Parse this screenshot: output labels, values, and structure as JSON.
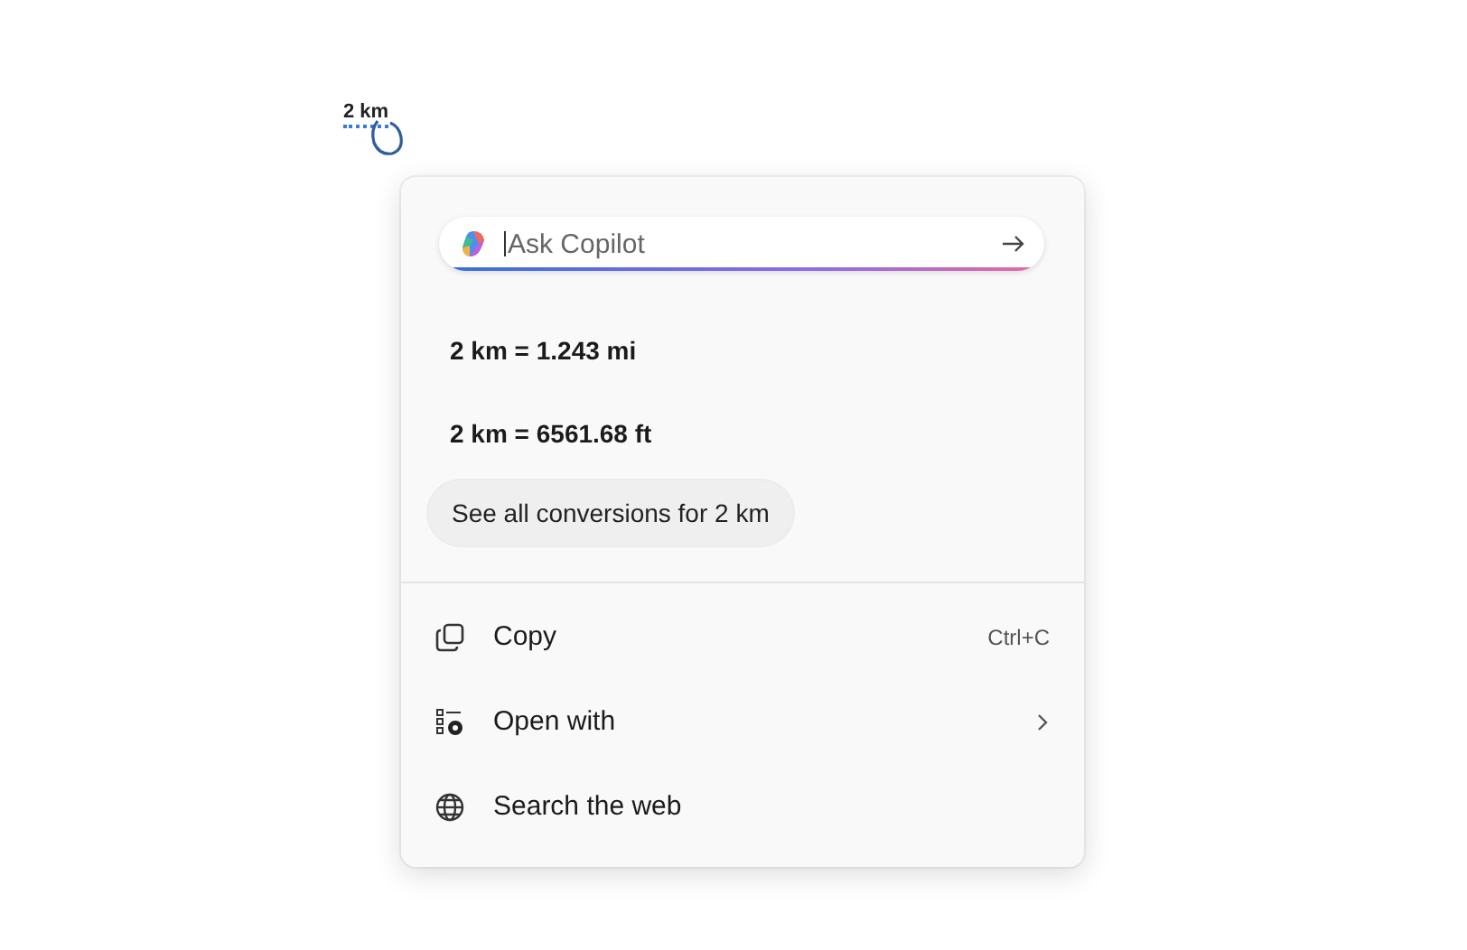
{
  "selection": {
    "text": "2 km"
  },
  "copilot_field": {
    "placeholder": "Ask Copilot"
  },
  "results": [
    {
      "text": "2 km = 1.243 mi"
    },
    {
      "text": "2 km = 6561.68 ft"
    }
  ],
  "see_all_button": {
    "label": "See all conversions for 2 km"
  },
  "menu_items": [
    {
      "kind": "copy",
      "label": "Copy",
      "shortcut": "Ctrl+C",
      "submenu": false
    },
    {
      "kind": "open-with",
      "label": "Open with",
      "submenu": true
    },
    {
      "kind": "search",
      "label": "Search the web",
      "submenu": false
    }
  ]
}
